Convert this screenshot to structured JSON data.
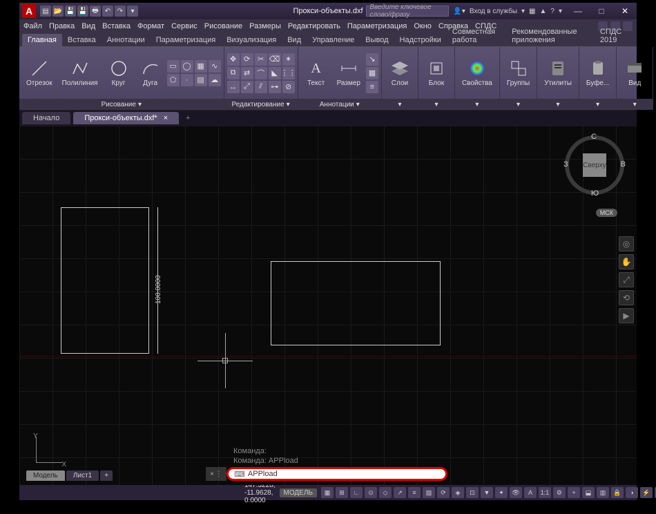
{
  "title": "Прокси-объекты.dxf",
  "logo_letter": "A",
  "search_placeholder": "Введите ключевое слово/фразу",
  "signin_label": "Вход в службы",
  "menu": [
    "Файл",
    "Правка",
    "Вид",
    "Вставка",
    "Формат",
    "Сервис",
    "Рисование",
    "Размеры",
    "Редактировать",
    "Параметризация",
    "Окно",
    "Справка",
    "СПДС"
  ],
  "ribbon_tabs": [
    "Главная",
    "Вставка",
    "Аннотации",
    "Параметризация",
    "Визуализация",
    "Вид",
    "Управление",
    "Вывод",
    "Надстройки",
    "Совместная работа",
    "Рекомендованные приложения",
    "СПДС 2019"
  ],
  "ribbon_active": "Главная",
  "panels": {
    "draw": {
      "title": "Рисование",
      "buttons": [
        {
          "label": "Отрезок"
        },
        {
          "label": "Полилиния"
        },
        {
          "label": "Круг"
        },
        {
          "label": "Дуга"
        }
      ]
    },
    "modify": {
      "title": "Редактирование"
    },
    "annotate": {
      "title": "Аннотации",
      "buttons": [
        {
          "label": "Текст"
        },
        {
          "label": "Размер"
        }
      ]
    },
    "layers": {
      "title": "",
      "button": "Слои"
    },
    "block": {
      "title": "",
      "button": "Блок"
    },
    "props": {
      "title": "",
      "button": "Свойства"
    },
    "groups": {
      "title": "",
      "button": "Группы"
    },
    "utils": {
      "title": "",
      "button": "Утилиты"
    },
    "clipboard": {
      "title": "",
      "button": "Буфе..."
    },
    "view": {
      "title": "",
      "button": "Вид"
    }
  },
  "file_tabs": [
    {
      "label": "Начало",
      "active": false
    },
    {
      "label": "Прокси-объекты.dxf*",
      "active": true
    }
  ],
  "viewcube": {
    "face": "Сверху",
    "n": "С",
    "s": "Ю",
    "e": "В",
    "w": "З",
    "wcs": "МСК"
  },
  "dimension_value": "100.0000",
  "cmd_history": [
    "Команда:",
    "Команда: APPload"
  ],
  "cmd_input": "APPload",
  "layout_tabs": [
    {
      "label": "Модель",
      "active": true
    },
    {
      "label": "Лист1",
      "active": false
    }
  ],
  "status": {
    "coords": "147.3228, -11.9628, 0.0000",
    "space": "МОДЕЛЬ",
    "scale": "1:1"
  },
  "ucs": {
    "x": "X",
    "y": "Y"
  }
}
